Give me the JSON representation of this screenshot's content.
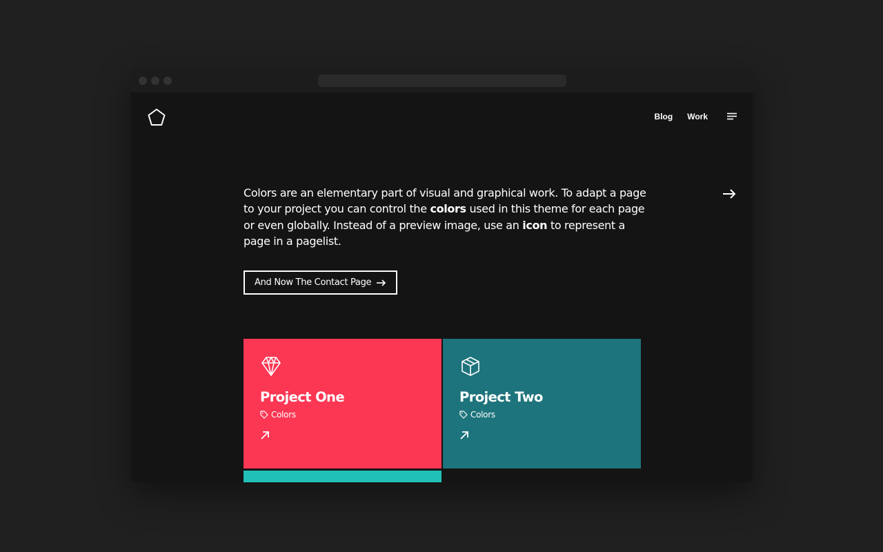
{
  "nav": {
    "items": [
      "Blog",
      "Work"
    ]
  },
  "icons": {
    "logo": "pentagon-icon",
    "menu": "hamburger-menu-icon",
    "next": "arrow-right-icon"
  },
  "intro": {
    "part1": "Colors are an elementary part of visual and graphical work. To adapt a page to your project you can control the ",
    "bold1": "colors",
    "part2": " used in this theme for each page or even globally. Instead of a preview image, use an ",
    "bold2": "icon",
    "part3": " to represent a page in a pagelist."
  },
  "cta": {
    "label": "And Now The Contact Page"
  },
  "projects": [
    {
      "title": "Project One",
      "tag": "Colors",
      "icon": "diamond-icon",
      "color": "#FB3754"
    },
    {
      "title": "Project Two",
      "tag": "Colors",
      "icon": "box-icon",
      "color": "#1E747C"
    },
    {
      "title": "",
      "tag": "",
      "icon": "",
      "color": "#21C0B7"
    }
  ],
  "colors": {
    "background": "#202020",
    "page": "#141414",
    "titlebar": "#1C1C1C"
  }
}
